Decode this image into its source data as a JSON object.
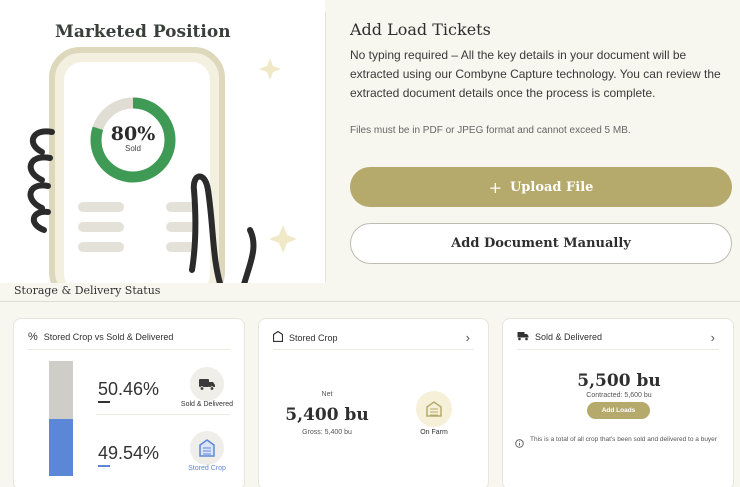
{
  "illustration": {
    "title": "Marketed Position",
    "gauge_percent": "80%",
    "gauge_caption": "Sold",
    "gauge_fraction": 0.8
  },
  "load_tickets": {
    "title": "Add Load Tickets",
    "description": "No typing required – All the key details in your document will be extracted using our Combyne Capture technology. You can review the extracted document details once the process is complete.",
    "note": "Files must be in PDF or JPEG format and cannot exceed 5 MB.",
    "upload_icon": "+",
    "upload_label": "Upload File",
    "manual_label": "Add Document Manually"
  },
  "section_title": "Storage & Delivery Status",
  "card_stored_vs_sold": {
    "title": "Stored Crop vs Sold & Delivered",
    "title_icon": "%",
    "sold_percent": "50.46%",
    "sold_label": "Sold & Delivered",
    "stored_percent": "49.54%",
    "stored_label": "Stored Crop",
    "stored_fraction": 0.4954
  },
  "card_stored_crop": {
    "title": "Stored Crop",
    "net_label": "Net",
    "net_value": "5,400 bu",
    "gross": "Gross: 5,400 bu",
    "location_label": "On Farm"
  },
  "card_sold_delivered": {
    "title": "Sold & Delivered",
    "value": "5,500 bu",
    "contracted": "Contracted: 5,600 bu",
    "add_loads_label": "Add Loads",
    "info_text": "This is a total of all crop that's been sold and delivered to a buyer"
  },
  "colors": {
    "accent_gold": "#b5aa6b",
    "gauge_green": "#3f9a56",
    "stored_blue": "#5c86d6",
    "sold_gray": "#cfcdc7"
  }
}
